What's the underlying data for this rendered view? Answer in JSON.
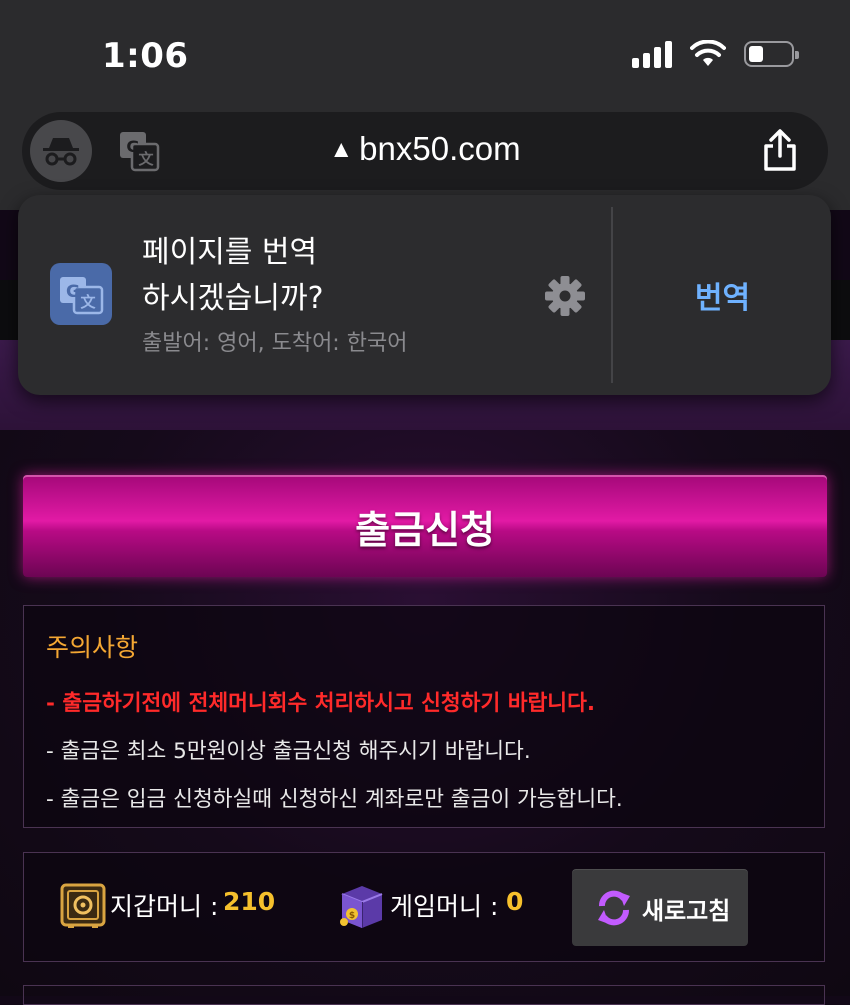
{
  "status_bar": {
    "time": "1:06"
  },
  "browser": {
    "url": "bnx50.com",
    "icons": [
      "incognito-icon",
      "google-translate-icon",
      "warning-icon",
      "share-icon"
    ]
  },
  "translate_popup": {
    "prompt_line1": "페이지를 번역",
    "prompt_line2": "하시겠습니까?",
    "language_info": "출발어: 영어, 도착어: 한국어",
    "action_label": "번역"
  },
  "page": {
    "title": "출금신청",
    "notice": {
      "heading": "주의사항",
      "lines": [
        "- 출금하기전에 전체머니회수 처리하시고 신청하기 바랍니다.",
        "- 출금은 최소 5만원이상 출금신청 해주시기 바랍니다.",
        "- 출금은 입금 신청하실때 신청하신 계좌로만 출금이 가능합니다."
      ]
    },
    "wallet": {
      "wallet_money_label": "지갑머니 :",
      "wallet_money_value": "210",
      "game_money_label": "게임머니 :",
      "game_money_value": "0",
      "refresh_label": "새로고침"
    }
  },
  "colors": {
    "accent_pink": "#e21aa5",
    "notice_heading": "#f4a733",
    "warning_red": "#ff2a2a",
    "value_gold": "#f6c02c",
    "translate_blue": "#6fb2ff"
  }
}
